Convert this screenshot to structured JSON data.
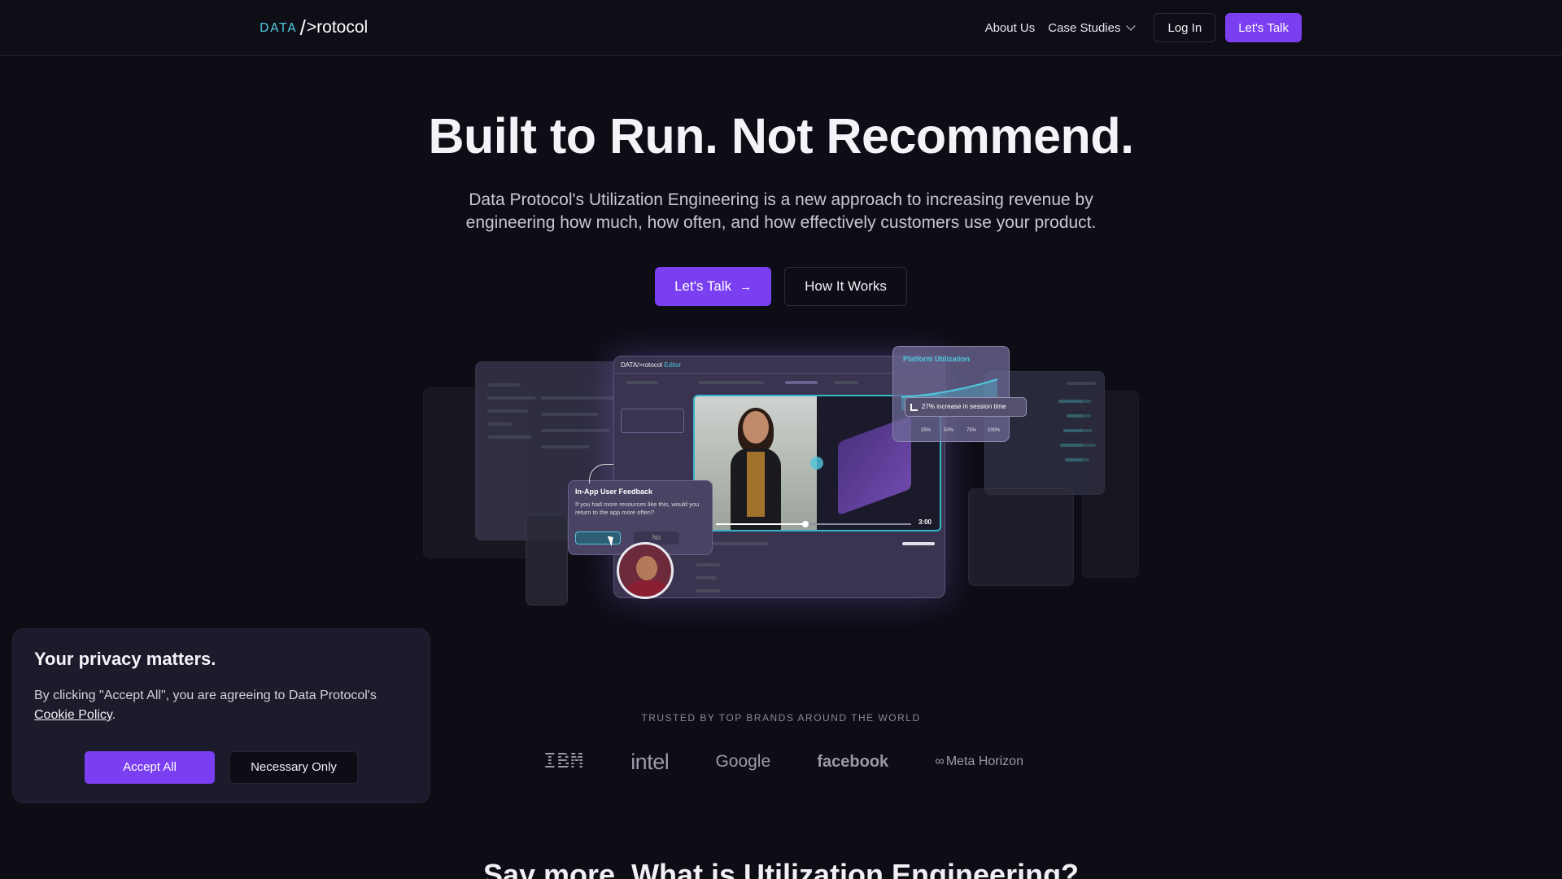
{
  "nav": {
    "logo_data": "DATA",
    "logo_slash": "/",
    "logo_rest": ">rotocol",
    "links": [
      "About Us",
      "Case Studies"
    ],
    "login": "Log In",
    "cta": "Let's Talk"
  },
  "hero": {
    "title": "Built to Run. Not Recommend.",
    "subtitle": "Data Protocol's Utilization Engineering is a new approach to increasing revenue by engineering how much, how often, and how effectively customers use your product.",
    "cta_primary": "Let's Talk",
    "cta_arrow": "→",
    "cta_secondary": "How It Works"
  },
  "collage": {
    "editor_logo": "DATA/>rotocol",
    "editor_label": "Editor",
    "video_time": "3:00",
    "feedback_title": "In-App User Feedback",
    "feedback_question": "If you had more resources like this, would you return to the app more often?",
    "feedback_no": "No",
    "util_title": "Platform Utilization",
    "util_chip": "27% increase in session time",
    "util_axis": [
      "25%",
      "50%",
      "75%",
      "100%"
    ]
  },
  "brands": {
    "label": "TRUSTED BY TOP BRANDS AROUND THE WORLD",
    "logos": [
      "IBM",
      "intel",
      "Google",
      "facebook",
      "Meta Horizon"
    ]
  },
  "cookie": {
    "title": "Your privacy matters.",
    "text": "By clicking \"Accept All\", you are agreeing to Data Protocol's",
    "link": "Cookie Policy",
    "period": ".",
    "accept": "Accept All",
    "necessary": "Necessary Only"
  },
  "next_section": {
    "title": "Say more. What is Utilization Engineering?"
  },
  "colors": {
    "accent": "#7b3ff2",
    "teal": "#4fc6dc",
    "background": "#0d0d16"
  }
}
